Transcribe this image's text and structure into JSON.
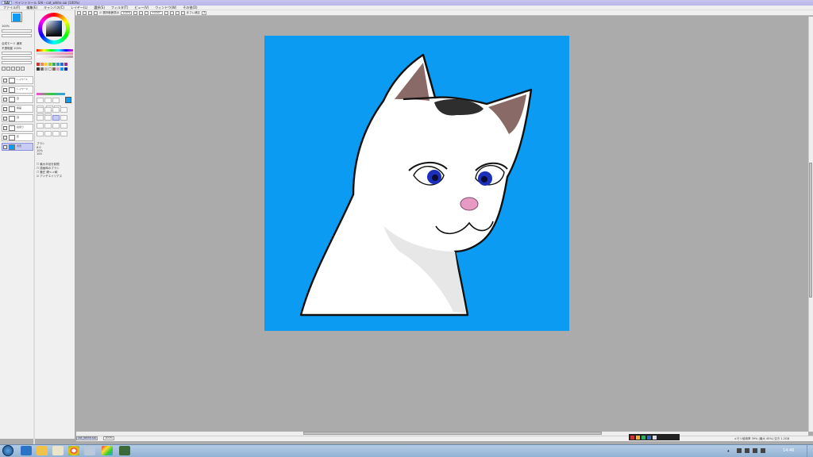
{
  "app": {
    "logo_label": "SAI",
    "window_title": "ペイントツール SAI - cat_white.sai (100%)"
  },
  "menu": [
    {
      "label": "ファイル(F)"
    },
    {
      "label": "編集(E)"
    },
    {
      "label": "キャンバス(C)"
    },
    {
      "label": "レイヤー(L)"
    },
    {
      "label": "選択(S)"
    },
    {
      "label": "フィルタ(T)"
    },
    {
      "label": "ビュー(V)"
    },
    {
      "label": "ウィンドウ(W)"
    },
    {
      "label": "その他(O)"
    }
  ],
  "toolbar": {
    "selection_checkbox_label": "選択範囲表示",
    "zoom_value": "100%",
    "rotation_value": "+000°",
    "stabilizer_label": "手ブレ補正",
    "stabilizer_value": "3"
  },
  "left_panel": {
    "color_hex": "#0d3f94",
    "opacity_label": "不透明度",
    "opacity_value": "100%",
    "blend_label": "合成モード",
    "blend_value": "通常"
  },
  "layers": [
    {
      "name": "レイヤー1"
    },
    {
      "name": "レイヤー2"
    },
    {
      "name": "目"
    },
    {
      "name": "線画"
    },
    {
      "name": "耳"
    },
    {
      "name": "白塗り"
    },
    {
      "name": "影"
    },
    {
      "name": "背景"
    }
  ],
  "tool_options": {
    "brush_label": "ブラシ",
    "brush_size": "6.0",
    "min_size": "10%",
    "density": "100",
    "options": [
      "最大半径を制限",
      "描画時のブラシ",
      "筆圧 硬<->軟",
      "アンチエイリアス"
    ]
  },
  "statusbar": {
    "file_tab": "cat_white.sai",
    "zoom_tab": "100%",
    "memory": "メモリ使用率 39% (最大 45%) 空き 1.2GB"
  },
  "taskbar": {
    "time": "14:46"
  },
  "colors": {
    "canvas_bg": "#0c9bf2",
    "cat_white": "#ffffff",
    "ear_inner": "#8a6a66",
    "eye_iris": "#1c2fb8",
    "nose": "#e79bc4",
    "head_patch": "#2e2e2e",
    "titlebar": "#bfbcee"
  }
}
